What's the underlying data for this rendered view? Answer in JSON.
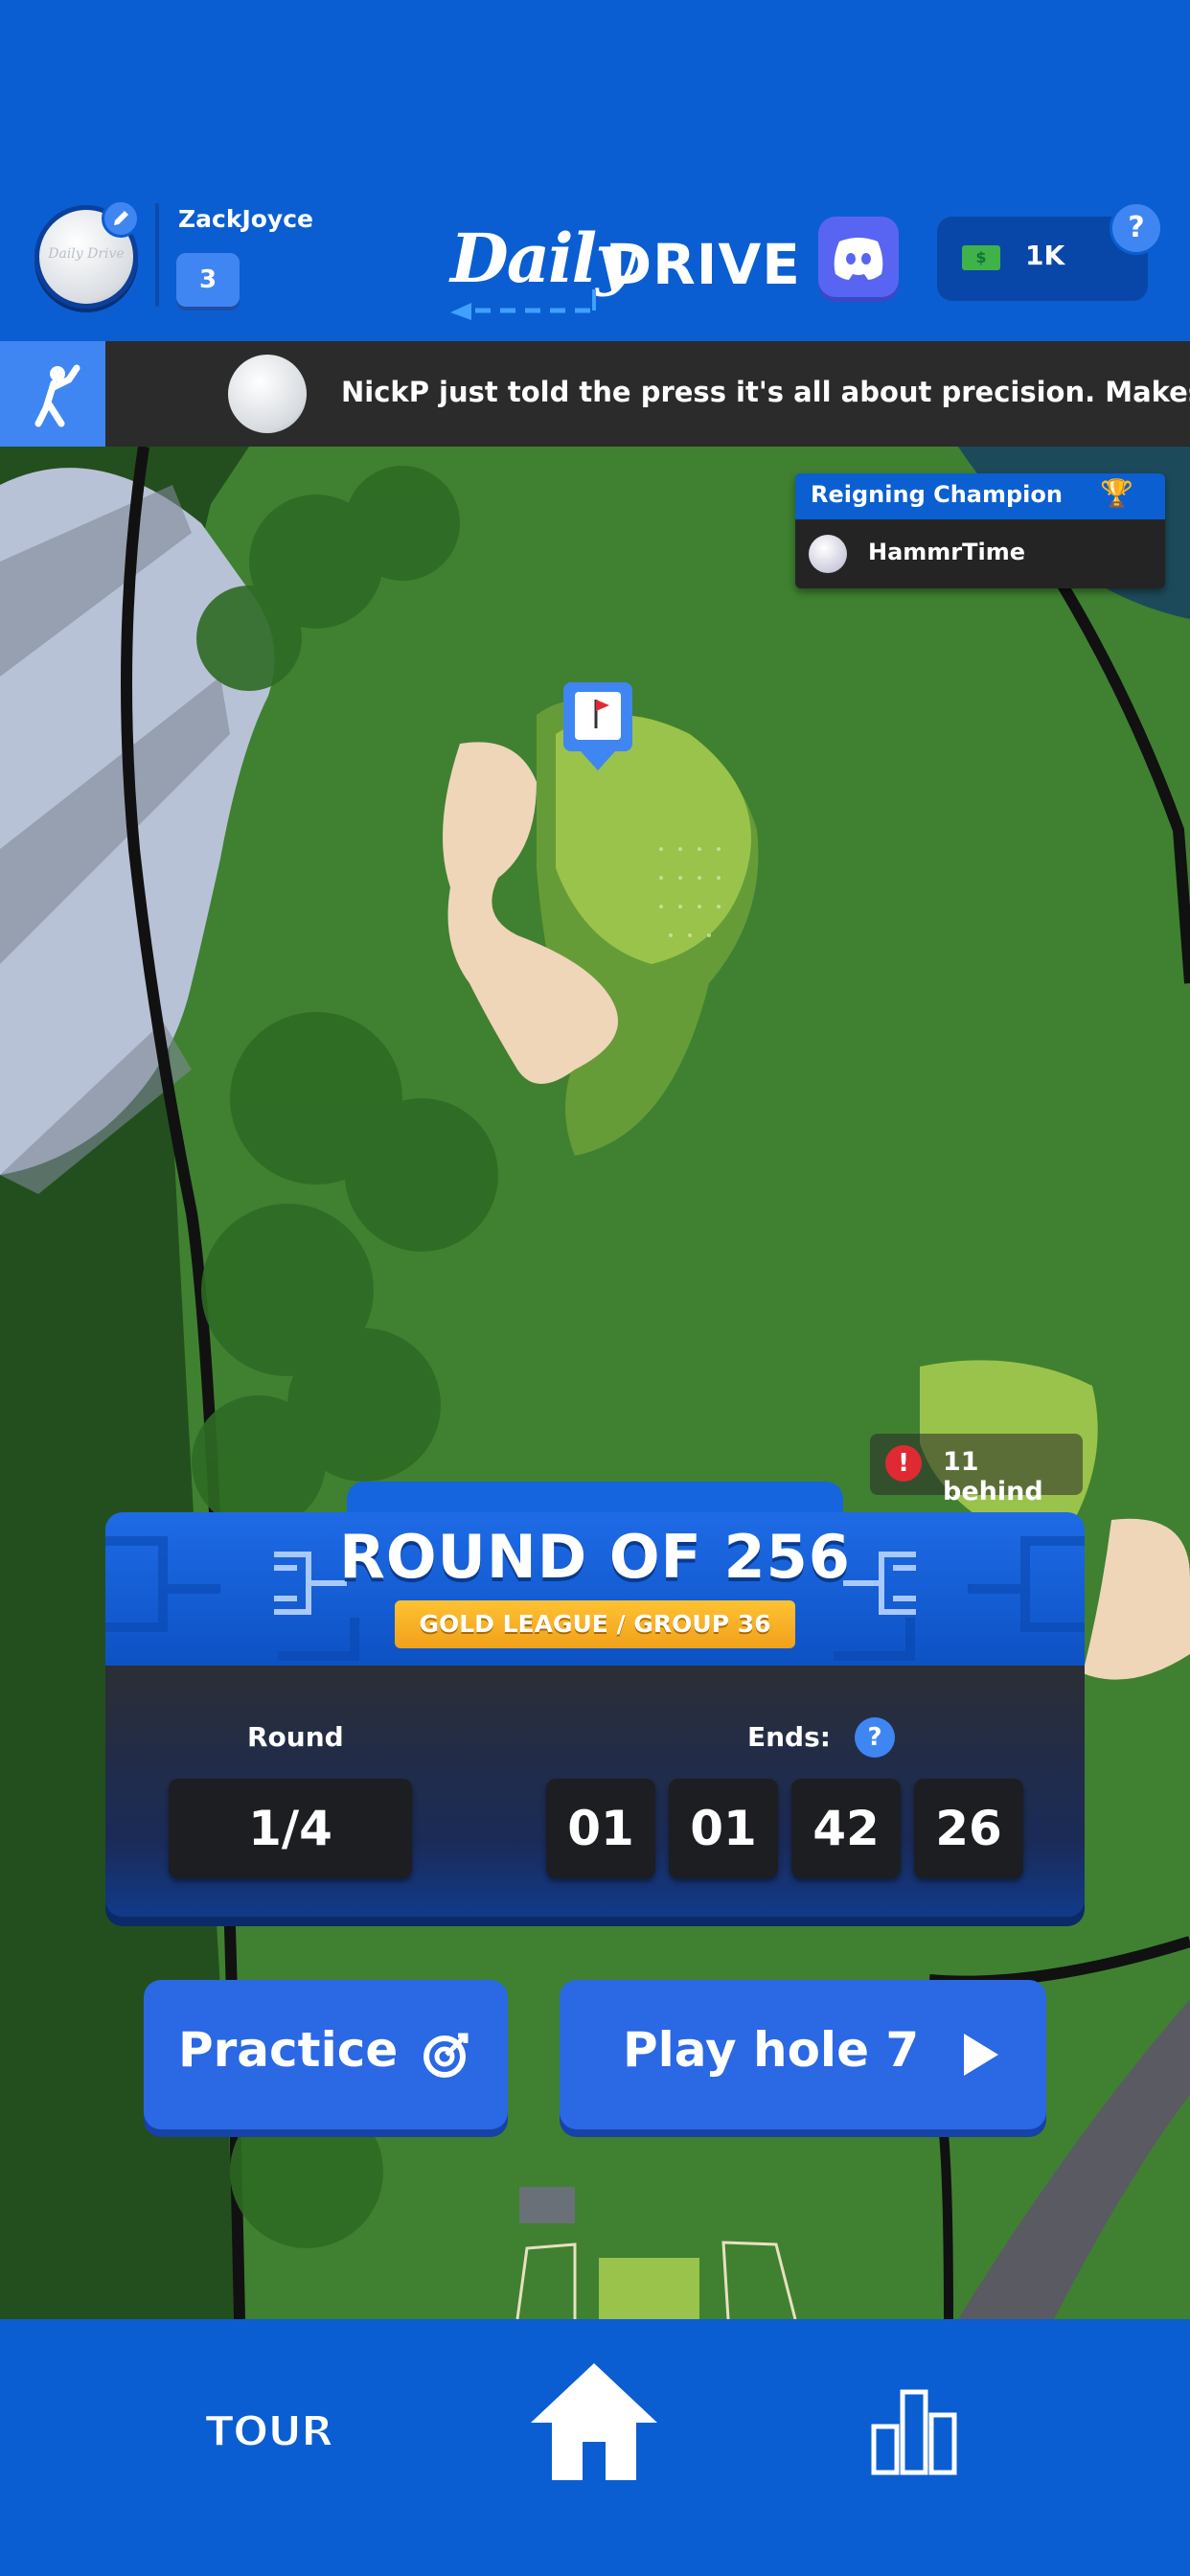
{
  "header": {
    "username": "ZackJoyce",
    "level": "3",
    "avatar_text": "Daily Drive",
    "logo_daily": "Daily",
    "logo_drive": "DRIVE",
    "cash": "1K",
    "cash_icon_text": "$",
    "help": "?"
  },
  "ticker": {
    "message": "NickP just told the press it's all about precision. Makes sense"
  },
  "champion": {
    "title": "Reigning Champion",
    "name": "HammrTime"
  },
  "status": {
    "behind_text": "11 behind",
    "alert_icon": "!"
  },
  "tournament": {
    "title": "ROUND OF 256",
    "league": "GOLD LEAGUE / GROUP 36",
    "round_label": "Round",
    "round_value": "1/4",
    "ends_label": "Ends:",
    "ends_help": "?",
    "countdown": [
      "01",
      "01",
      "42",
      "26"
    ]
  },
  "actions": {
    "practice_label": "Practice",
    "play_label": "Play hole 7"
  },
  "nav": {
    "tour_label": "TOUR"
  },
  "colors": {
    "brand_blue": "#0a5ed1",
    "button_blue": "#2a68e4",
    "gold": "#f4b81e",
    "alert_red": "#e02a33",
    "discord": "#5865f2"
  }
}
